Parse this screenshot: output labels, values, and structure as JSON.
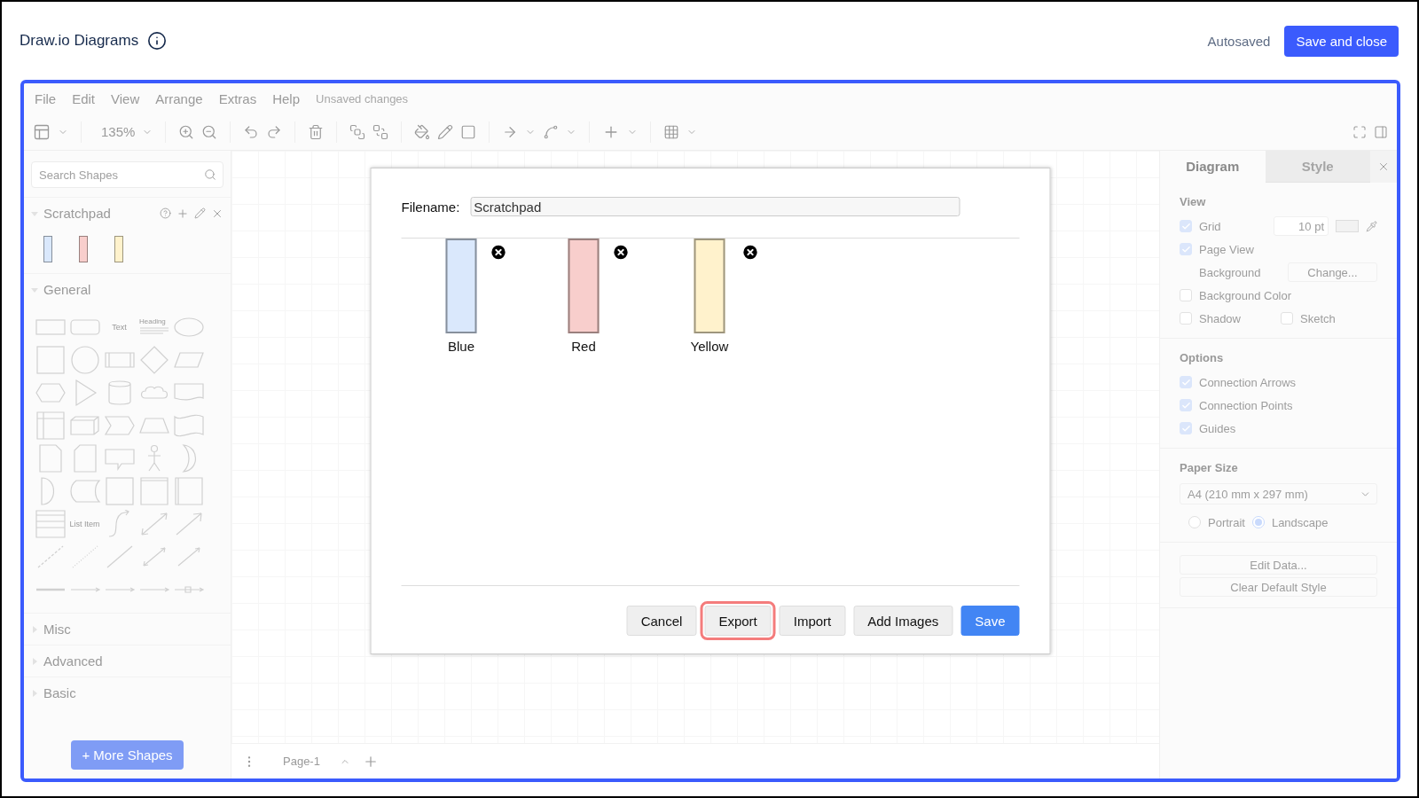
{
  "header": {
    "title": "Draw.io Diagrams",
    "status": "Autosaved",
    "save_button": "Save and close"
  },
  "menu": {
    "items": [
      "File",
      "Edit",
      "View",
      "Arrange",
      "Extras",
      "Help"
    ],
    "status": "Unsaved changes"
  },
  "toolbar": {
    "zoom": "135%"
  },
  "sidebar": {
    "search": {
      "placeholder": "Search Shapes"
    },
    "sections": [
      {
        "title": "Scratchpad",
        "expanded": true,
        "kind": "scratchpad"
      },
      {
        "title": "General",
        "expanded": true,
        "kind": "general"
      },
      {
        "title": "Misc",
        "expanded": false,
        "kind": "other"
      },
      {
        "title": "Advanced",
        "expanded": false,
        "kind": "other"
      },
      {
        "title": "Basic",
        "expanded": false,
        "kind": "other"
      }
    ],
    "palette": [
      {
        "kind": "rectangle"
      },
      {
        "kind": "rounded-rectangle"
      },
      {
        "kind": "text",
        "label": "Text"
      },
      {
        "kind": "heading",
        "label": "Heading"
      },
      {
        "kind": "ellipse"
      },
      {
        "kind": "square"
      },
      {
        "kind": "circle"
      },
      {
        "kind": "process"
      },
      {
        "kind": "diamond"
      },
      {
        "kind": "parallelogram"
      },
      {
        "kind": "hexagon"
      },
      {
        "kind": "triangle"
      },
      {
        "kind": "cylinder"
      },
      {
        "kind": "cloud"
      },
      {
        "kind": "document"
      },
      {
        "kind": "internal-storage"
      },
      {
        "kind": "cube"
      },
      {
        "kind": "step"
      },
      {
        "kind": "trapezoid"
      },
      {
        "kind": "tape"
      },
      {
        "kind": "note"
      },
      {
        "kind": "card"
      },
      {
        "kind": "callout"
      },
      {
        "kind": "actor"
      },
      {
        "kind": "crescent"
      },
      {
        "kind": "half-circle"
      },
      {
        "kind": "data-storage"
      },
      {
        "kind": "square"
      },
      {
        "kind": "container"
      },
      {
        "kind": "vertical-container"
      },
      {
        "kind": "list"
      },
      {
        "kind": "text",
        "label": "List Item"
      },
      {
        "kind": "curved-arrow"
      },
      {
        "kind": "double-arrow"
      },
      {
        "kind": "arrow"
      },
      {
        "kind": "dashed-line"
      },
      {
        "kind": "dotted-line"
      },
      {
        "kind": "line"
      },
      {
        "kind": "double-arrow-line"
      },
      {
        "kind": "arrow-line"
      },
      {
        "kind": "thick-line"
      },
      {
        "kind": "connector"
      },
      {
        "kind": "connector"
      },
      {
        "kind": "connector"
      },
      {
        "kind": "box-connector"
      }
    ],
    "more_button": "+ More Shapes"
  },
  "canvas": {
    "page_tab": "Page-1"
  },
  "format_panel": {
    "tabs": [
      {
        "label": "Diagram",
        "selected": true
      },
      {
        "label": "Style",
        "selected": false
      }
    ],
    "view": {
      "title": "View",
      "grid": {
        "label": "Grid",
        "checked": true,
        "size": "10 pt"
      },
      "page_view": {
        "label": "Page View",
        "checked": true
      },
      "background": {
        "label": "Background",
        "button": "Change..."
      },
      "background_color": {
        "label": "Background Color",
        "checked": false
      },
      "shadow": {
        "label": "Shadow",
        "checked": false
      },
      "sketch": {
        "label": "Sketch",
        "checked": false
      }
    },
    "options": {
      "title": "Options",
      "items": [
        {
          "label": "Connection Arrows",
          "checked": true
        },
        {
          "label": "Connection Points",
          "checked": true
        },
        {
          "label": "Guides",
          "checked": true
        }
      ]
    },
    "paper": {
      "title": "Paper Size",
      "value": "A4 (210 mm x 297 mm)",
      "orientations": [
        {
          "label": "Portrait",
          "selected": false
        },
        {
          "label": "Landscape",
          "selected": true
        }
      ]
    },
    "buttons": [
      "Edit Data...",
      "Clear Default Style"
    ]
  },
  "dialog": {
    "filename_label": "Filename:",
    "filename": "Scratchpad",
    "items": [
      {
        "label": "Blue",
        "color": "#dae8fc"
      },
      {
        "label": "Red",
        "color": "#f8cecc"
      },
      {
        "label": "Yellow",
        "color": "#fff2cc"
      }
    ],
    "buttons": [
      {
        "label": "Cancel",
        "kind": "plain",
        "focused": false
      },
      {
        "label": "Export",
        "kind": "plain",
        "focused": true
      },
      {
        "label": "Import",
        "kind": "plain",
        "focused": false
      },
      {
        "label": "Add Images",
        "kind": "plain",
        "focused": false
      },
      {
        "label": "Save",
        "kind": "primary",
        "focused": false
      }
    ]
  }
}
